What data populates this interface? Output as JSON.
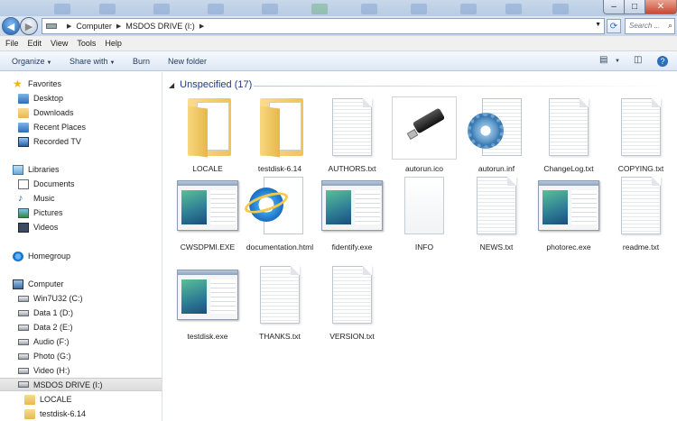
{
  "window": {
    "address_parts": [
      "Computer",
      "MSDOS DRIVE (I:)"
    ],
    "search_placeholder": "Search ...",
    "controls": {
      "minimize": "–",
      "maximize": "□",
      "close": "✕"
    }
  },
  "menu": [
    "File",
    "Edit",
    "View",
    "Tools",
    "Help"
  ],
  "commands": {
    "organize": "Organize",
    "share_with": "Share with",
    "burn": "Burn",
    "new_folder": "New folder"
  },
  "sidebar": {
    "favorites": {
      "label": "Favorites",
      "items": [
        "Desktop",
        "Downloads",
        "Recent Places",
        "Recorded TV"
      ]
    },
    "libraries": {
      "label": "Libraries",
      "items": [
        "Documents",
        "Music",
        "Pictures",
        "Videos"
      ]
    },
    "homegroup": "Homegroup",
    "computer": {
      "label": "Computer",
      "drives": [
        "Win7U32 (C:)",
        "Data 1 (D:)",
        "Data 2 (E:)",
        "Audio (F:)",
        "Photo (G:)",
        "Video (H:)",
        "MSDOS DRIVE (I:)"
      ],
      "selected": "MSDOS DRIVE (I:)",
      "subfolders": [
        "LOCALE",
        "testdisk-6.14"
      ]
    }
  },
  "content": {
    "group_title": "Unspecified (17)",
    "files": [
      {
        "name": "LOCALE",
        "icon": "folder-icon"
      },
      {
        "name": "testdisk-6.14",
        "icon": "folder-icon"
      },
      {
        "name": "AUTHORS.txt",
        "icon": "text-file-icon"
      },
      {
        "name": "autorun.ico",
        "icon": "usb-drive-icon"
      },
      {
        "name": "autorun.inf",
        "icon": "settings-file-icon"
      },
      {
        "name": "ChangeLog.txt",
        "icon": "text-file-icon"
      },
      {
        "name": "COPYING.txt",
        "icon": "text-file-icon"
      },
      {
        "name": "CWSDPMI.EXE",
        "icon": "application-icon"
      },
      {
        "name": "documentation.html",
        "icon": "internet-explorer-icon"
      },
      {
        "name": "fidentify.exe",
        "icon": "application-icon"
      },
      {
        "name": "INFO",
        "icon": "blank-file-icon"
      },
      {
        "name": "NEWS.txt",
        "icon": "text-file-icon"
      },
      {
        "name": "photorec.exe",
        "icon": "application-icon"
      },
      {
        "name": "readme.txt",
        "icon": "text-file-icon"
      },
      {
        "name": "testdisk.exe",
        "icon": "application-icon"
      },
      {
        "name": "THANKS.txt",
        "icon": "text-file-icon"
      },
      {
        "name": "VERSION.txt",
        "icon": "text-file-icon"
      }
    ]
  }
}
